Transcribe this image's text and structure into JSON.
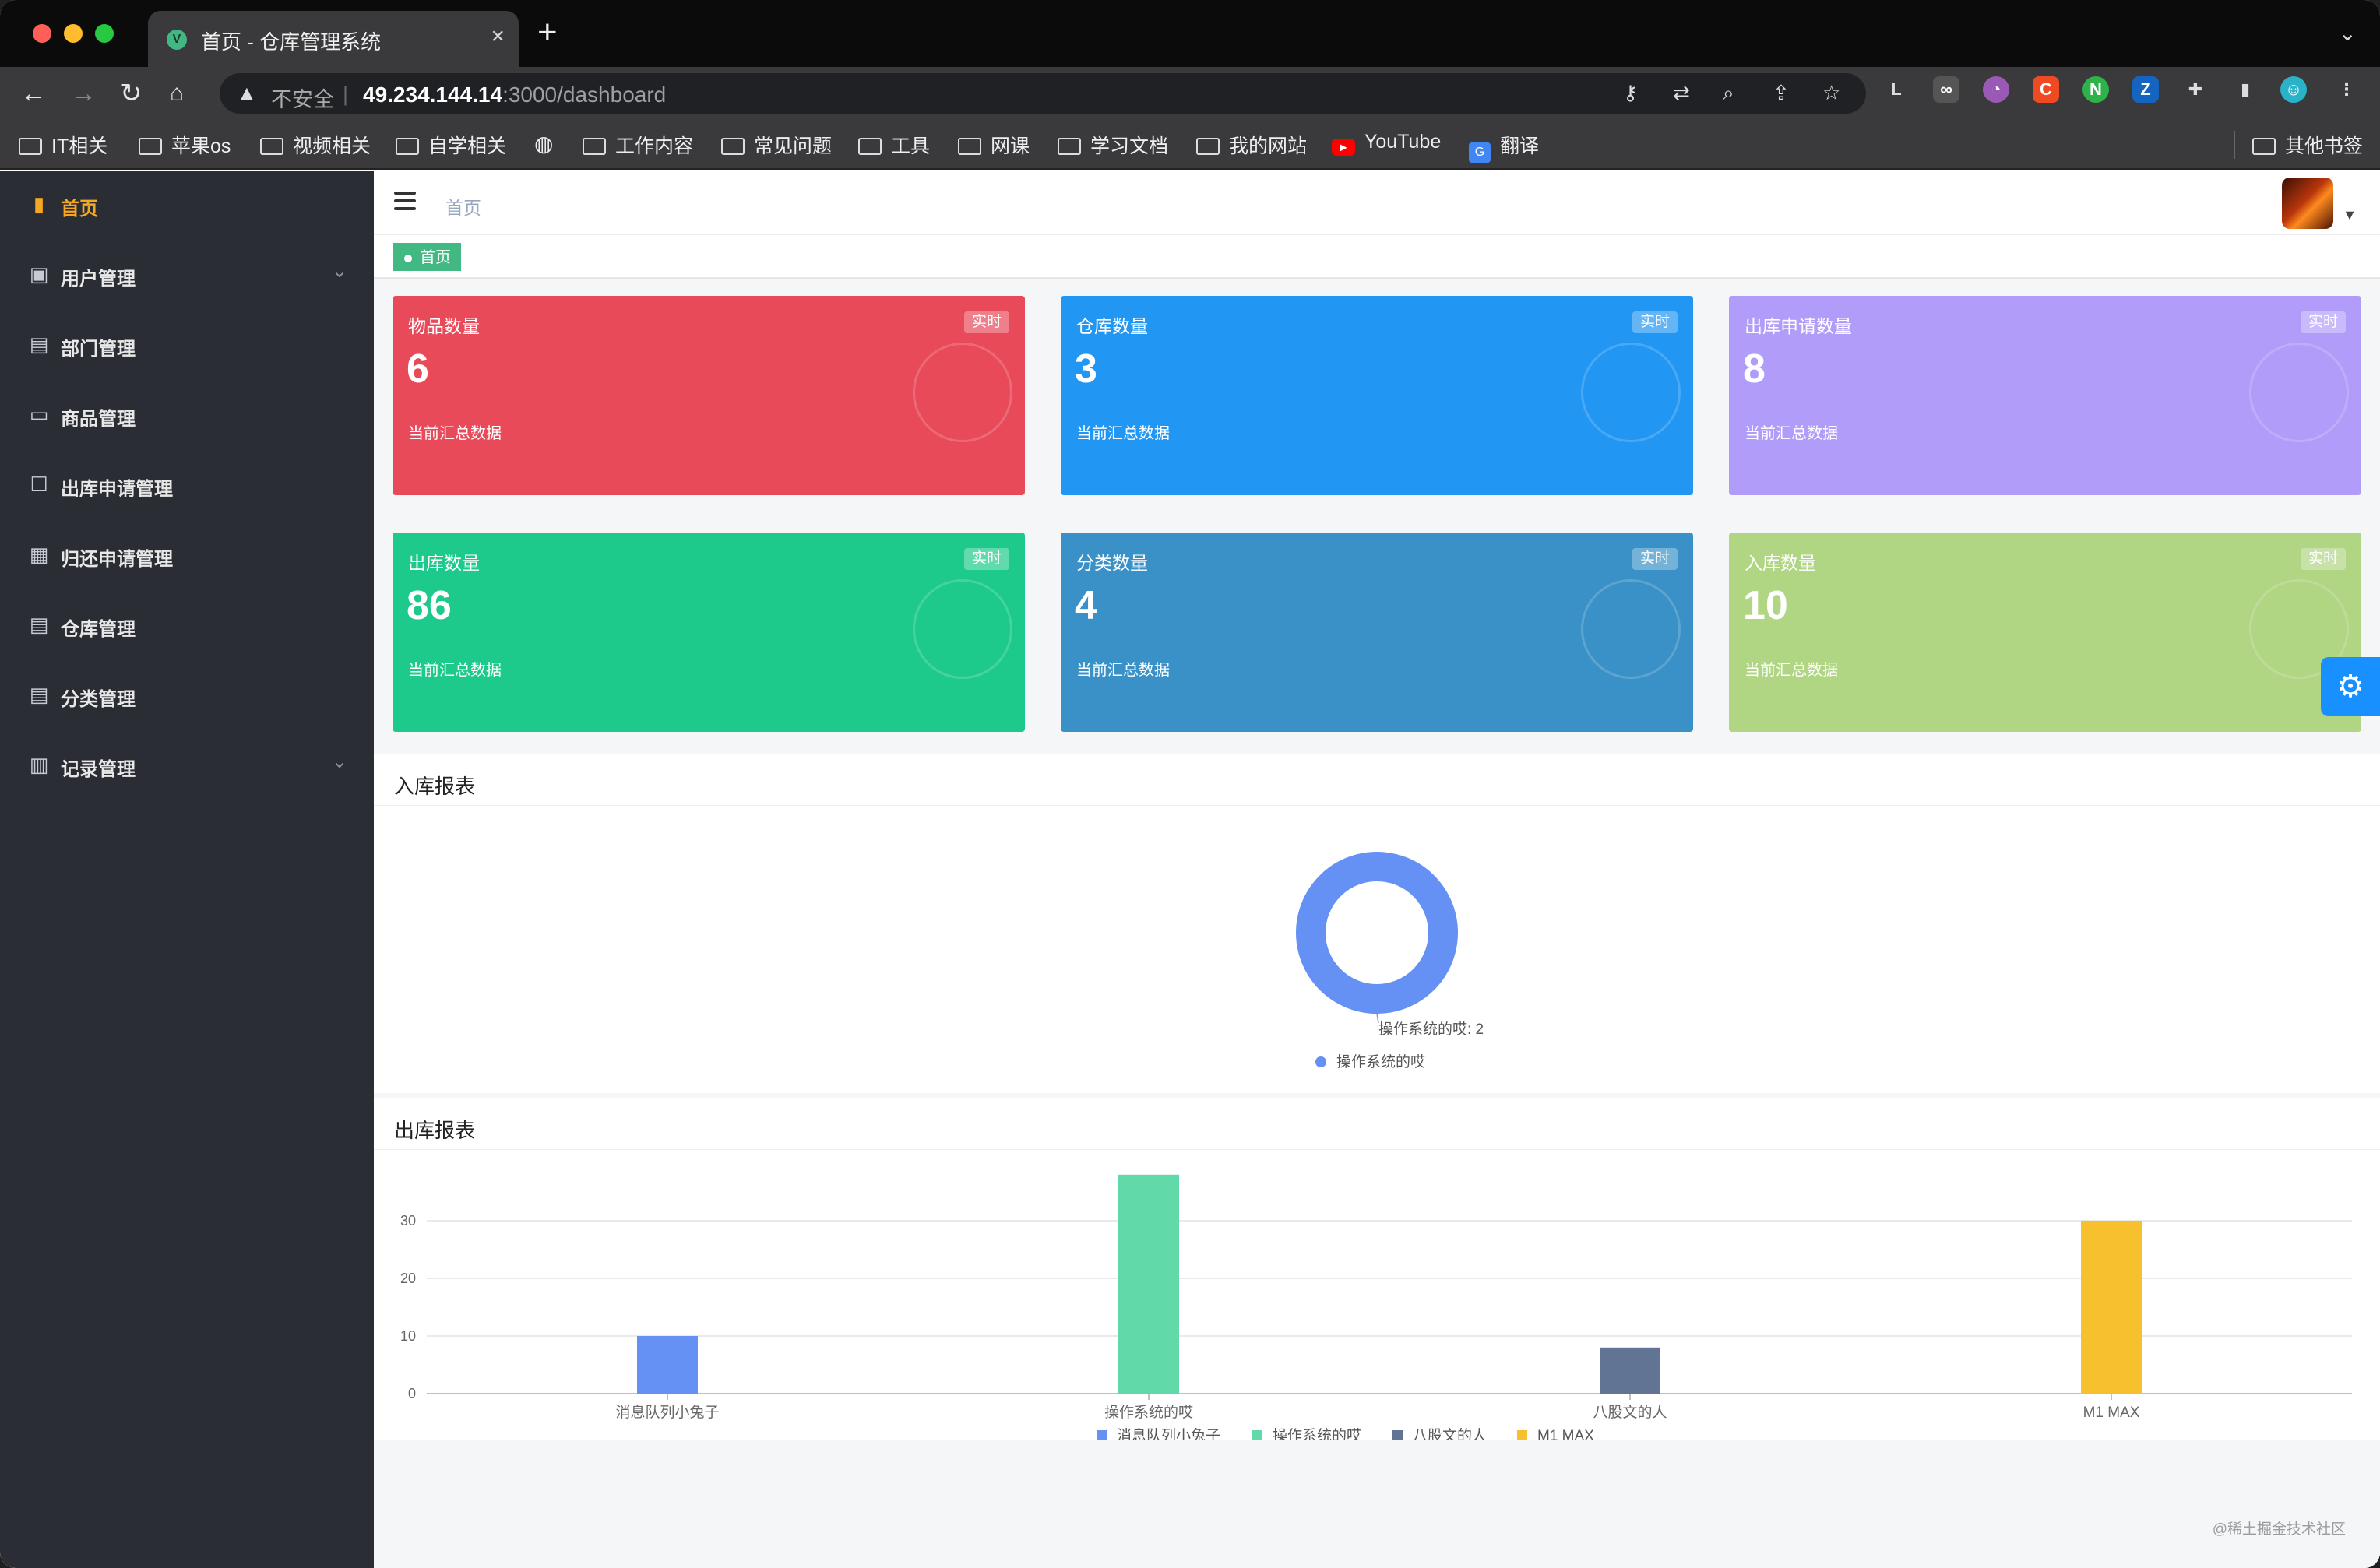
{
  "browser": {
    "tab_title": "首页 - 仓库管理系统",
    "tab_favicon": "V",
    "new_tab": "+",
    "url_insecure_label": "不安全",
    "url_host": "49.234.144.14",
    "url_rest": ":3000/dashboard",
    "bookmarks": [
      "IT相关",
      "苹果os",
      "视频相关",
      "自学相关",
      "工作内容",
      "常见问题",
      "工具",
      "网课",
      "学习文档",
      "我的网站",
      "YouTube",
      "翻译"
    ],
    "other_bookmarks": "其他书签",
    "colors": {
      "traffic_red": "#ff5f57",
      "traffic_yellow": "#febc2e",
      "traffic_green": "#28c840"
    }
  },
  "sidebar": {
    "items": [
      {
        "label": "首页",
        "icon": "bar-chart-icon",
        "active": true
      },
      {
        "label": "用户管理",
        "icon": "clipboard-icon",
        "has_children": true
      },
      {
        "label": "部门管理",
        "icon": "document-icon"
      },
      {
        "label": "商品管理",
        "icon": "box-icon"
      },
      {
        "label": "出库申请管理",
        "icon": "checklist-icon"
      },
      {
        "label": "归还申请管理",
        "icon": "save-icon"
      },
      {
        "label": "仓库管理",
        "icon": "document-icon"
      },
      {
        "label": "分类管理",
        "icon": "document-icon"
      },
      {
        "label": "记录管理",
        "icon": "records-icon",
        "has_children": true
      }
    ],
    "colors": {
      "background": "#2a2d33",
      "active": "#f5a623"
    }
  },
  "header": {
    "breadcrumb": "首页",
    "tag": "首页"
  },
  "cards": [
    {
      "title": "物品数量",
      "badge": "实时",
      "value": "6",
      "footer": "当前汇总数据",
      "color": "#e84a5a"
    },
    {
      "title": "仓库数量",
      "badge": "实时",
      "value": "3",
      "footer": "当前汇总数据",
      "color": "#2196f3"
    },
    {
      "title": "出库申请数量",
      "badge": "实时",
      "value": "8",
      "footer": "当前汇总数据",
      "color": "#b19cf9"
    },
    {
      "title": "出库数量",
      "badge": "实时",
      "value": "86",
      "footer": "当前汇总数据",
      "color": "#1dca8c"
    },
    {
      "title": "分类数量",
      "badge": "实时",
      "value": "4",
      "footer": "当前汇总数据",
      "color": "#3a91c7"
    },
    {
      "title": "入库数量",
      "badge": "实时",
      "value": "10",
      "footer": "当前汇总数据",
      "color": "#b0d583"
    }
  ],
  "inbound_panel": {
    "title": "入库报表"
  },
  "outbound_panel": {
    "title": "出库报表"
  },
  "chart_data": [
    {
      "type": "pie",
      "title": "",
      "style": "donut",
      "categories": [
        "操作系统的哎"
      ],
      "values": [
        2
      ],
      "label": "操作系统的哎: 2",
      "legend": [
        "操作系统的哎"
      ],
      "legend_position": "bottom",
      "colors": [
        "#6591f5"
      ]
    },
    {
      "type": "bar",
      "title": "",
      "categories": [
        "消息队列小兔子",
        "操作系统的哎",
        "八股文的人",
        "M1 MAX"
      ],
      "values": [
        10,
        38,
        8,
        30
      ],
      "yticks": [
        0,
        10,
        20,
        30
      ],
      "ylim": [
        0,
        40
      ],
      "grid": true,
      "legend": [
        "消息队列小兔子",
        "操作系统的哎",
        "八股文的人",
        "M1 MAX"
      ],
      "legend_position": "bottom",
      "colors": [
        "#6591f5",
        "#61d9a8",
        "#617494",
        "#f6c02f"
      ]
    }
  ],
  "watermark": "@稀土掘金技术社区"
}
